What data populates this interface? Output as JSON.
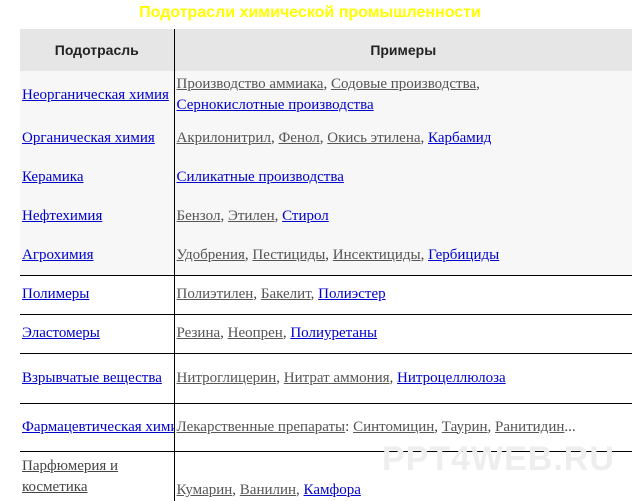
{
  "title": "Подотрасли химической промышленности",
  "headers": {
    "branch": "Подотрасль",
    "examples": "Примеры"
  },
  "rows": [
    {
      "branch": "Неорганическая химия",
      "ex": [
        {
          "t": "Производство аммиака"
        },
        {
          "t": ", "
        },
        {
          "t": "Содовые производства"
        },
        {
          "t": ", "
        },
        {
          "t": "Сернокислотные производства"
        }
      ]
    },
    {
      "branch": "Органическая химия",
      "ex": [
        {
          "t": "Акрилонитрил"
        },
        {
          "t": ", "
        },
        {
          "t": "Фенол"
        },
        {
          "t": ", "
        },
        {
          "t": "Окись этилена"
        },
        {
          "t": ", "
        },
        {
          "t": "Карбамид"
        }
      ]
    },
    {
      "branch": "Керамика",
      "ex": [
        {
          "t": "Силикатные производства"
        }
      ]
    },
    {
      "branch": "Нефтехимия",
      "ex": [
        {
          "t": "Бензол"
        },
        {
          "t": ", "
        },
        {
          "t": "Этилен"
        },
        {
          "t": ", "
        },
        {
          "t": "Стирол"
        }
      ]
    },
    {
      "branch": "Агрохимия",
      "ex": [
        {
          "t": "Удобрения"
        },
        {
          "t": ", "
        },
        {
          "t": "Пестициды"
        },
        {
          "t": ", "
        },
        {
          "t": "Инсектициды"
        },
        {
          "t": ", "
        },
        {
          "t": "Гербициды"
        }
      ]
    },
    {
      "branch": "Полимеры",
      "ex": [
        {
          "t": "Полиэтилен"
        },
        {
          "t": ", "
        },
        {
          "t": "Бакелит"
        },
        {
          "t": ", "
        },
        {
          "t": "Полиэстер"
        }
      ]
    },
    {
      "branch": "Эластомеры",
      "ex": [
        {
          "t": "Резина"
        },
        {
          "t": ", "
        },
        {
          "t": "Неопрен"
        },
        {
          "t": ", "
        },
        {
          "t": "Полиуретаны"
        }
      ]
    },
    {
      "branch": "Взрывчатые вещества",
      "ex": [
        {
          "t": "Нитроглицерин"
        },
        {
          "t": ", "
        },
        {
          "t": "Нитрат аммония"
        },
        {
          "t": ", "
        },
        {
          "t": "Нитроцеллюлоза"
        }
      ]
    },
    {
      "branch": "Фармацевтическая химия",
      "ex": [
        {
          "t": "Лекарственные препараты"
        },
        {
          "t": ": "
        },
        {
          "t": "Синтомицин"
        },
        {
          "t": ", "
        },
        {
          "t": "Таурин"
        },
        {
          "t": ", "
        },
        {
          "t": "Ранитидин"
        },
        {
          "t": "..."
        }
      ]
    },
    {
      "branch": "Парфюмерия и косметика",
      "ex": [
        {
          "t": "Кумарин"
        },
        {
          "t": ", "
        },
        {
          "t": "Ванилин"
        },
        {
          "t": ", "
        },
        {
          "t": "Камфора"
        }
      ]
    }
  ],
  "watermark": "PPT4WEB.RU"
}
